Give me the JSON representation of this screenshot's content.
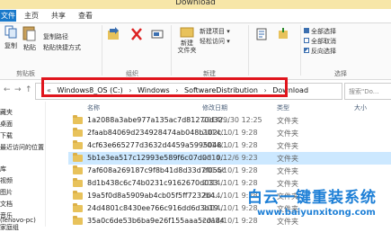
{
  "window": {
    "title": "Download"
  },
  "tabs": [
    {
      "label": "文件"
    },
    {
      "label": "主页"
    },
    {
      "label": "共享"
    },
    {
      "label": "查看"
    }
  ],
  "ribbon": {
    "copy_label": "复制",
    "paste_label": "粘贴",
    "copy_path_label": "复制路径",
    "paste_shortcut_label": "粘贴快捷方式",
    "clipboard_group": "剪贴板",
    "organize_group": "组织",
    "new_item_label": "新建项目",
    "easy_access_label": "轻松访问",
    "new_folder_label": "新建\n文件夹",
    "new_group": "新建",
    "select_all_label": "全部选择",
    "select_none_label": "全部取消",
    "invert_label": "反向选择",
    "select_group": "选择"
  },
  "address": {
    "crumbs": [
      "Windows8_OS (C:)",
      "Windows",
      "SoftwareDistribution",
      "Download"
    ],
    "search_placeholder": "搜索\"Do...",
    "highlight_color": "#e0151d"
  },
  "nav": {
    "items": [
      "藏夹",
      "桌面",
      "下载",
      "最近访问的位置",
      "库",
      "视频",
      "图片",
      "文档",
      "音乐",
      "家庭组",
      "(lenovo-pc)"
    ]
  },
  "columns": {
    "name": "名称",
    "date": "修改日期",
    "type": "类型",
    "size": "大小"
  },
  "files": [
    {
      "name": "1a2088a3abe977a135ac7d81270d32...",
      "date": "2014/9/30 12:25",
      "type": "文件夹"
    },
    {
      "name": "2faab84069d234928474ab048b102c...",
      "date": "2014/10/1 9:28",
      "type": "文件夹"
    },
    {
      "name": "4cf63e665277d3632d4459a5995048...",
      "date": "2014/10/1 9:28",
      "type": "文件夹"
    },
    {
      "name": "5b1e3ea517c12993e589f6c07d0d10...",
      "date": "2014/12/6 9:23",
      "type": "文件夹"
    },
    {
      "name": "7af608a269187c9f8b41d8d33d7f055c",
      "date": "2014/10/1 9:28",
      "type": "文件夹"
    },
    {
      "name": "8d1b438c6c74b0231c9162670d033...",
      "date": "2014/10/1 9:28",
      "type": "文件夹"
    },
    {
      "name": "19a5f0d8a5909ab4cb05f5ff7232b4...",
      "date": "2014/10/1 9:28",
      "type": "文件夹"
    },
    {
      "name": "24d4801c8430ee766c916dd6d3b19...",
      "date": "2014/10/1 9:28",
      "type": "文件夹"
    },
    {
      "name": "35a0c6de53b6ba9e26f155aaa5cda84",
      "date": "2014/10/1 9:28",
      "type": "文件夹"
    }
  ],
  "watermark": {
    "text": "白云一键重装系统",
    "url": "www.baiyunxitong.com"
  }
}
